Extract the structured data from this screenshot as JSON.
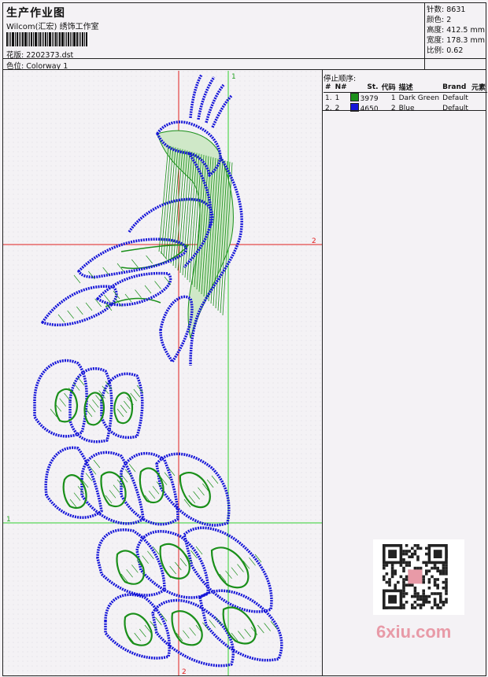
{
  "header": {
    "title": "生产作业图",
    "studio": "Wilcom(汇宏) 绣饰工作室",
    "design_label": "花版:",
    "design_value": "2202373.dst",
    "colorway_label": "色位:",
    "colorway_value": "Colorway 1"
  },
  "stats": {
    "stitches_label": "针数:",
    "stitches": "8631",
    "colors_label": "颜色:",
    "colors": "2",
    "height_label": "高度:",
    "height": "412.5 mm",
    "width_label": "宽度:",
    "width": "178.3 mm",
    "scale_label": "比例:",
    "scale": "0.62"
  },
  "stop_sequence": {
    "title": "停止顺序:",
    "columns": [
      "#",
      "N#",
      "St.",
      "代码",
      "描述",
      "Brand",
      "元素"
    ],
    "rows": [
      {
        "idx": "1.",
        "n": "1",
        "color": "#1a8f1a",
        "stitches": "3979",
        "code": "1",
        "desc": "Dark Green",
        "brand": "Default"
      },
      {
        "idx": "2.",
        "n": "2",
        "color": "#1616d8",
        "stitches": "4650",
        "code": "2",
        "desc": "Blue",
        "brand": "Default"
      }
    ]
  },
  "guides": {
    "v1": "1",
    "v2": "2",
    "h1": "1",
    "h2": "2"
  },
  "watermark": "6xiu.com",
  "colors": {
    "green": "#1a8f1a",
    "blue": "#1616d8",
    "red_guide": "#e02020",
    "green_guide": "#30d030"
  }
}
